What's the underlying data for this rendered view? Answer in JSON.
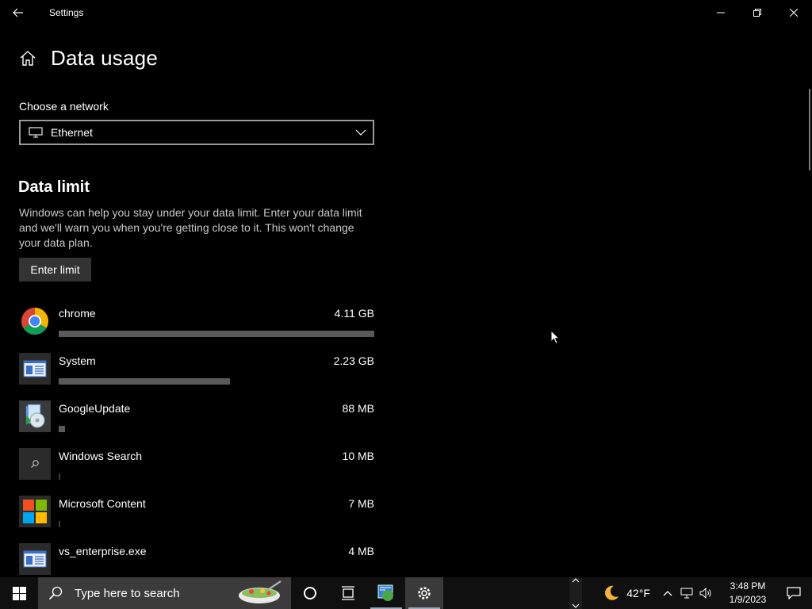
{
  "window": {
    "title": "Settings"
  },
  "header": {
    "title": "Data usage"
  },
  "network": {
    "label": "Choose a network",
    "selected": "Ethernet"
  },
  "data_limit": {
    "title": "Data limit",
    "description": "Windows can help you stay under your data limit. Enter your data limit and we'll warn you when you're getting close to it. This won't change your data plan.",
    "button_label": "Enter limit"
  },
  "apps": [
    {
      "name": "chrome",
      "size": "4.11 GB",
      "fraction": 1.0,
      "icon": "chrome-icon"
    },
    {
      "name": "System",
      "size": "2.23 GB",
      "fraction": 0.543,
      "icon": "system-window-icon"
    },
    {
      "name": "GoogleUpdate",
      "size": "88 MB",
      "fraction": 0.021,
      "icon": "google-update-icon"
    },
    {
      "name": "Windows Search",
      "size": "10 MB",
      "fraction": 0.0024,
      "icon": "search-icon"
    },
    {
      "name": "Microsoft Content",
      "size": "7 MB",
      "fraction": 0.0017,
      "icon": "microsoft-logo-icon"
    },
    {
      "name": "vs_enterprise.exe",
      "size": "4 MB",
      "fraction": 0.001,
      "icon": "system-window-icon"
    }
  ],
  "taskbar": {
    "search_placeholder": "Type here to search",
    "weather_temp": "42°F",
    "time": "3:48 PM",
    "date": "1/9/2023"
  },
  "colors": {
    "background": "#000000",
    "bar": "#5a5a5a",
    "button": "#333333",
    "taskbar": "#101010"
  }
}
